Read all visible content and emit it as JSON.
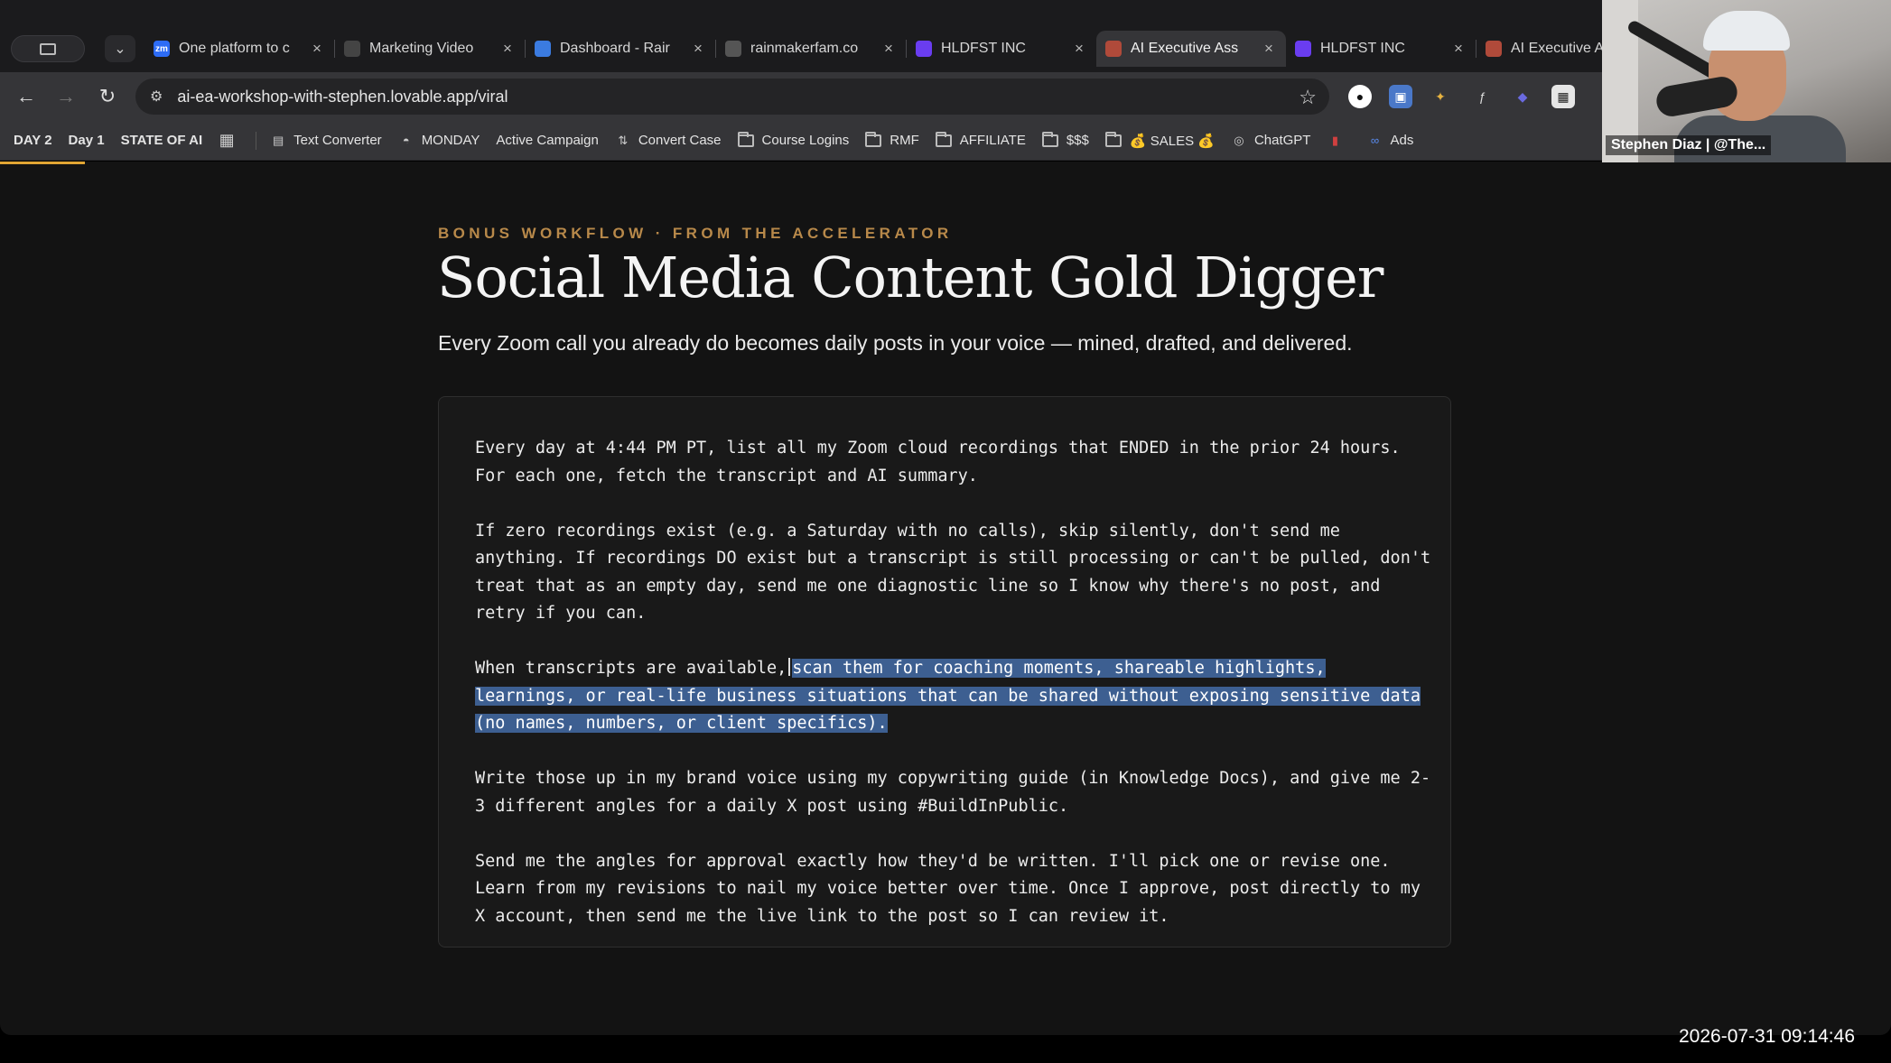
{
  "tabs": [
    {
      "title": "One platform to c",
      "icon": "zoom-icon",
      "color": "#2d6cf6",
      "glyph": "zm"
    },
    {
      "title": "Marketing Video",
      "icon": "marketing-icon",
      "color": "#444444",
      "glyph": ""
    },
    {
      "title": "Dashboard - Rair",
      "icon": "share-icon",
      "color": "#3b7be0",
      "glyph": ""
    },
    {
      "title": "rainmakerfam.co",
      "icon": "globe-icon",
      "color": "#555555",
      "glyph": ""
    },
    {
      "title": "HLDFST INC",
      "icon": "hldfst-icon",
      "color": "#6a3df0",
      "glyph": ""
    },
    {
      "title": "AI Executive Ass",
      "icon": "ai-ea-icon",
      "color": "#b04a3a",
      "glyph": ""
    },
    {
      "title": "HLDFST INC",
      "icon": "hldfst-icon",
      "color": "#6a3df0",
      "glyph": ""
    },
    {
      "title": "AI Executive Ass",
      "icon": "ai-ea-icon",
      "color": "#b04a3a",
      "glyph": ""
    }
  ],
  "active_tab_index": 5,
  "address": {
    "url": "ai-ea-workshop-with-stephen.lovable.app/viral"
  },
  "bookmarks": [
    {
      "label": "DAY 2",
      "kind": "text",
      "strong": true
    },
    {
      "label": "Day 1",
      "kind": "text",
      "strong": true
    },
    {
      "label": "STATE OF AI",
      "kind": "text",
      "strong": true
    },
    {
      "label": "",
      "kind": "apps"
    },
    {
      "label": "Text Converter",
      "kind": "icon",
      "icon": "text-converter-icon"
    },
    {
      "label": "MONDAY",
      "kind": "icon",
      "icon": "monday-icon"
    },
    {
      "label": "Active Campaign",
      "kind": "text"
    },
    {
      "label": "Convert Case",
      "kind": "icon",
      "icon": "convert-case-icon"
    },
    {
      "label": "Course Logins",
      "kind": "folder"
    },
    {
      "label": "RMF",
      "kind": "folder"
    },
    {
      "label": "AFFILIATE",
      "kind": "folder"
    },
    {
      "label": "$$$",
      "kind": "folder"
    },
    {
      "label": "💰 SALES 💰",
      "kind": "folder"
    },
    {
      "label": "ChatGPT",
      "kind": "icon",
      "icon": "chatgpt-icon"
    },
    {
      "label": "",
      "kind": "icon",
      "icon": "chart-icon"
    },
    {
      "label": "Ads",
      "kind": "icon",
      "icon": "meta-icon"
    }
  ],
  "page": {
    "eyebrow": "BONUS WORKFLOW · FROM THE ACCELERATOR",
    "title": "Social Media Content Gold Digger",
    "subtitle": "Every Zoom call you already do becomes daily posts in your voice — mined, drafted, and delivered.",
    "prompt": {
      "p1": "Every day at 4:44 PM PT, list all my Zoom cloud recordings that ENDED in the prior 24 hours. For each one, fetch the transcript and AI summary.",
      "p2": "If zero recordings exist (e.g. a Saturday with no calls), skip silently, don't send me anything. If recordings DO exist but a transcript is still processing or can't be pulled, don't treat that as an empty day, send me one diagnostic line so I know why there's no post, and retry if you can.",
      "p3_before": "When transcripts are available,",
      "p3_selected": "scan them for coaching moments, shareable highlights, learnings, or real-life business situations that can be shared without exposing sensitive data (no names, numbers, or client specifics).",
      "p4": "Write those up in my brand voice using my copywriting guide (in Knowledge Docs), and give me 2-3 different angles for a daily X post using #BuildInPublic.",
      "p5": "Send me the angles for approval exactly how they'd be written. I'll pick one or revise one. Learn from my revisions to nail my voice better over time. Once I approve, post directly to my X account, then send me the live link to the post so I can review it."
    }
  },
  "webcam": {
    "name": "Stephen Diaz | @The..."
  },
  "timestamp": "2026-07-31  09:14:46",
  "colors": {
    "eyebrow": "#b8894a",
    "selection": "#3d5f91",
    "page_bg": "#131313",
    "card_bg": "#191919"
  }
}
